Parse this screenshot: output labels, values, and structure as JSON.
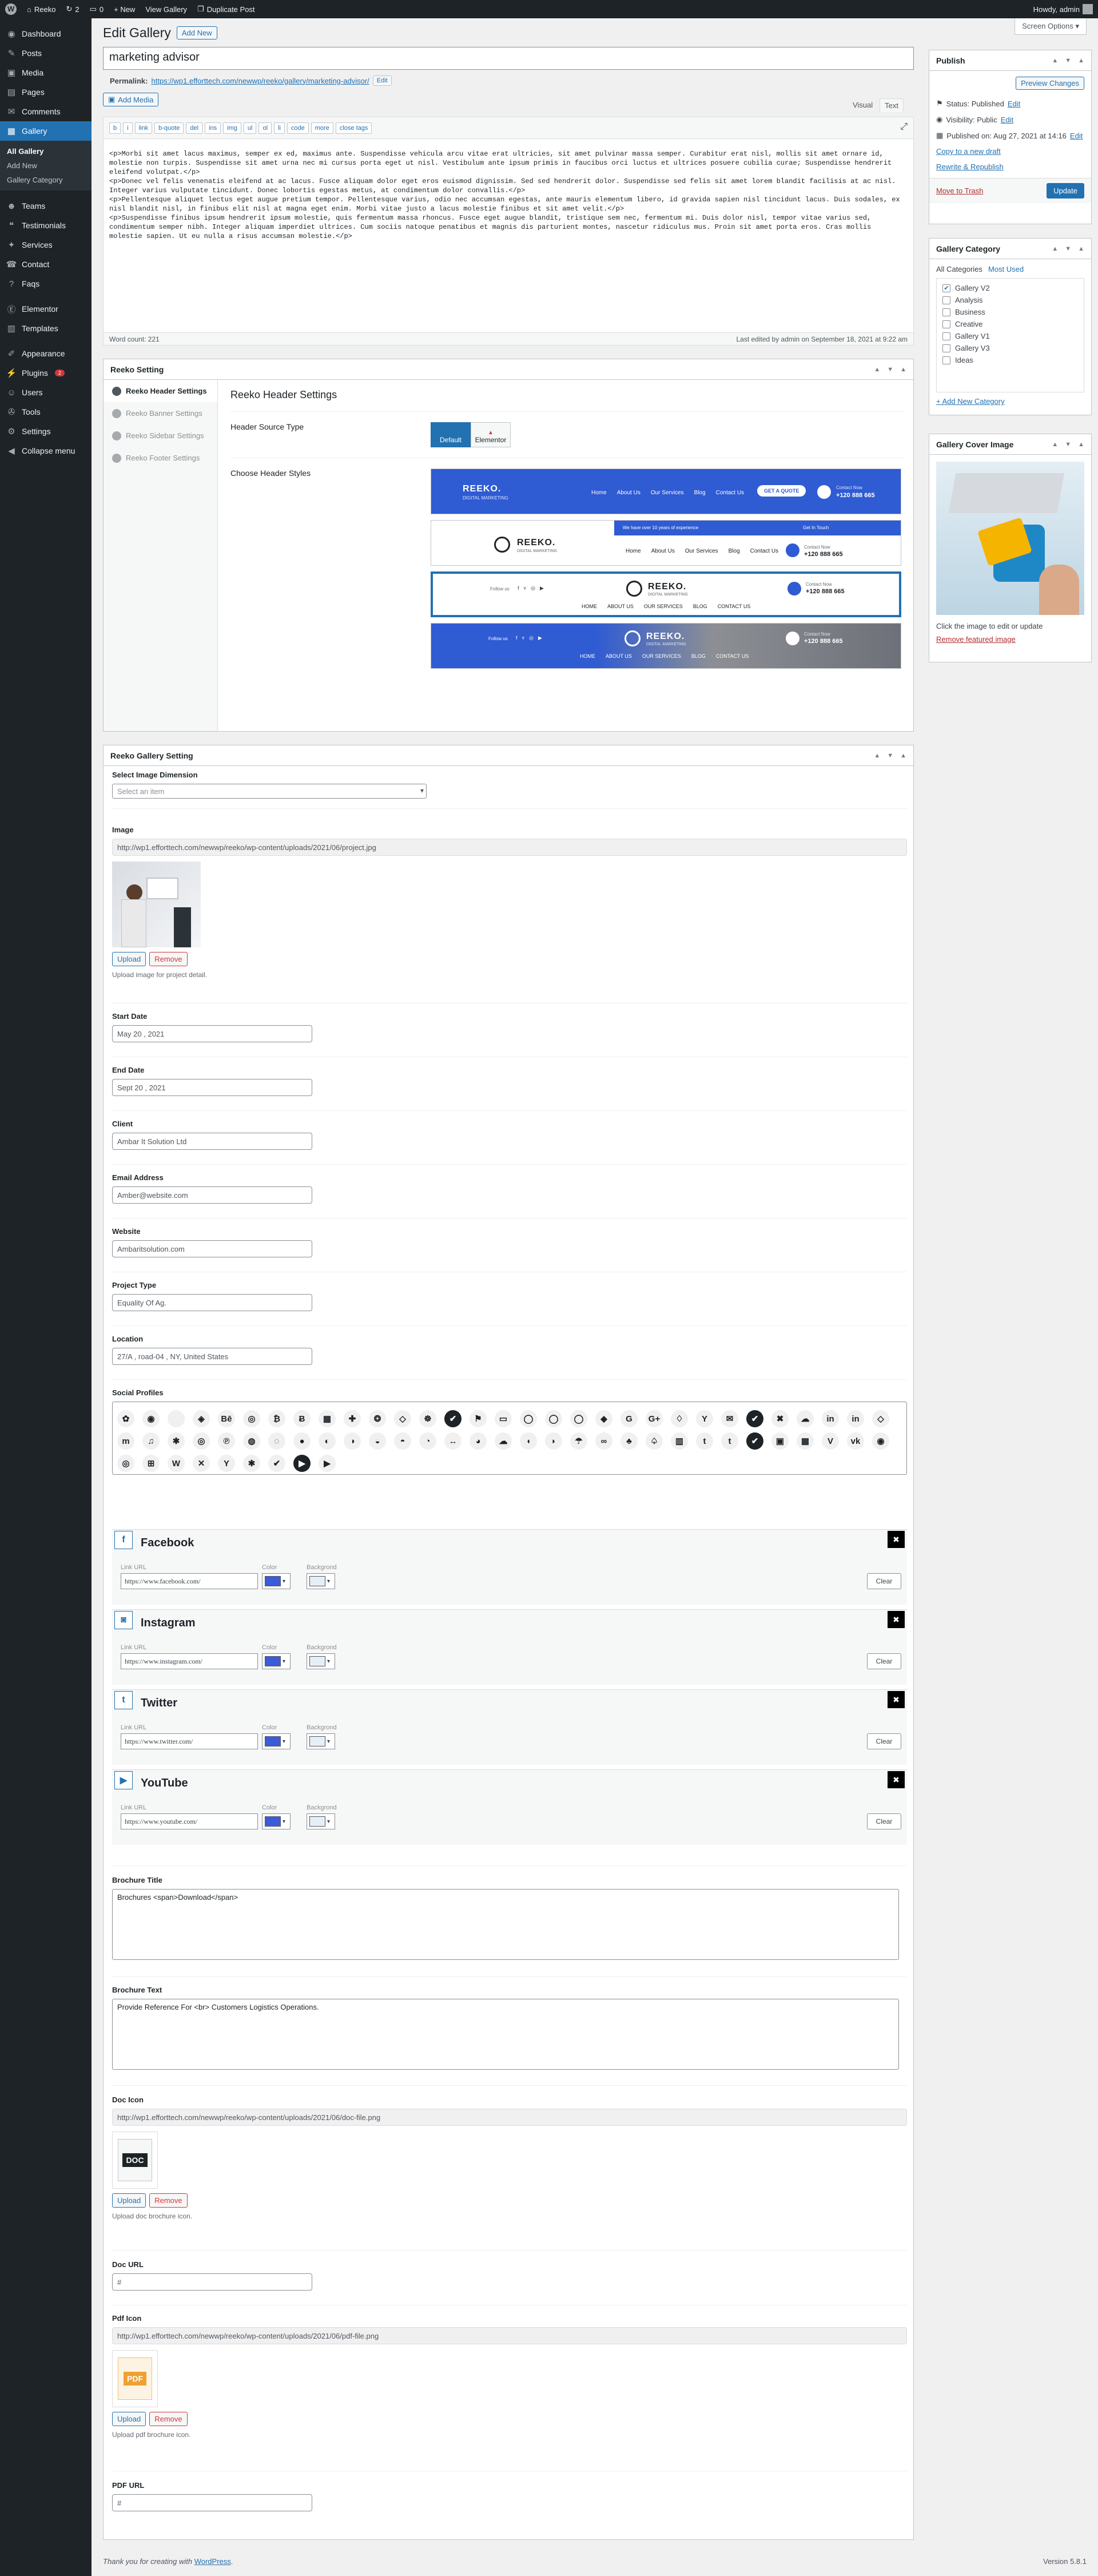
{
  "adminbar": {
    "site": "Reeko",
    "updates": "2",
    "comments": "0",
    "new": "+ New",
    "view": "View Gallery",
    "duplicate": "Duplicate Post",
    "howdy": "Howdy, admin"
  },
  "screen_options": "Screen Options",
  "sidebar": {
    "items": [
      {
        "label": "Dashboard",
        "icon": "dashboard-icon",
        "glyph": "◉"
      },
      {
        "label": "Posts",
        "icon": "pin-icon",
        "glyph": "✎"
      },
      {
        "label": "Media",
        "icon": "media-icon",
        "glyph": "▣"
      },
      {
        "label": "Pages",
        "icon": "pages-icon",
        "glyph": "▤"
      },
      {
        "label": "Comments",
        "icon": "comments-icon",
        "glyph": "✉"
      },
      {
        "label": "Gallery",
        "icon": "gallery-icon",
        "glyph": "▦"
      }
    ],
    "sub": [
      "All Gallery",
      "Add New",
      "Gallery Category"
    ],
    "items2": [
      {
        "label": "Teams",
        "icon": "teams-icon",
        "glyph": "☻"
      },
      {
        "label": "Testimonials",
        "icon": "testimonials-icon",
        "glyph": "❝"
      },
      {
        "label": "Services",
        "icon": "services-icon",
        "glyph": "✦"
      },
      {
        "label": "Contact",
        "icon": "contact-icon",
        "glyph": "☎"
      },
      {
        "label": "Faqs",
        "icon": "faqs-icon",
        "glyph": "?"
      }
    ],
    "items3": [
      {
        "label": "Elementor",
        "icon": "elementor-icon",
        "glyph": "Ⓔ"
      },
      {
        "label": "Templates",
        "icon": "templates-icon",
        "glyph": "▥"
      }
    ],
    "items4": [
      {
        "label": "Appearance",
        "icon": "appearance-icon",
        "glyph": "✐"
      },
      {
        "label": "Plugins",
        "icon": "plugins-icon",
        "glyph": "⚡",
        "badge": "2"
      },
      {
        "label": "Users",
        "icon": "users-icon",
        "glyph": "☺"
      },
      {
        "label": "Tools",
        "icon": "tools-icon",
        "glyph": "✇"
      },
      {
        "label": "Settings",
        "icon": "settings-icon",
        "glyph": "⚙"
      },
      {
        "label": "Collapse menu",
        "icon": "collapse-icon",
        "glyph": "◀"
      }
    ]
  },
  "page": {
    "title": "Edit Gallery",
    "add_new": "Add New",
    "post_title": "marketing advisor",
    "permalink_label": "Permalink:",
    "permalink_url": "https://wp1.efforttech.com/newwp/reeko/gallery/marketing-advisor/",
    "edit": "Edit",
    "add_media": "Add Media",
    "tab_visual": "Visual",
    "tab_text": "Text"
  },
  "editor": {
    "buttons": [
      "b",
      "i",
      "link",
      "b-quote",
      "del",
      "ins",
      "img",
      "ul",
      "ol",
      "li",
      "code",
      "more",
      "close tags"
    ],
    "content": "<p>Morbi sit amet lacus maximus, semper ex ed, maximus ante. Suspendisse vehicula arcu vitae erat ultricies, sit amet pulvinar massa semper. Curabitur erat nisl, mollis sit amet ornare id, molestie non turpis. Suspendisse sit amet urna nec mi cursus porta eget ut nisl. Vestibulum ante ipsum primis in faucibus orci luctus et ultrices posuere cubilia curae; Suspendisse hendrerit eleifend volutpat.</p>\n<p>Donec vel felis venenatis eleifend at ac lacus. Fusce aliquam dolor eget eros euismod dignissim. Sed sed hendrerit dolor. Suspendisse sed felis sit amet lorem blandit facilisis at ac nisl. Integer varius vulputate tincidunt. Donec lobortis egestas metus, at condimentum dolor convallis.</p>\n<p>Pellentesque aliquet lectus eget augue pretium tempor. Pellentesque varius, odio nec accumsan egestas, ante mauris elementum libero, id gravida sapien nisl tincidunt lacus. Duis sodales, ex nisl blandit nisl, in finibus elit nisl at magna eget enim. Morbi vitae justo a lacus molestie finibus et sit amet velit.</p>\n<p>Suspendisse finibus ipsum hendrerit ipsum molestie, quis fermentum massa rhoncus. Fusce eget augue blandit, tristique sem nec, fermentum mi. Duis dolor nisl, tempor vitae varius sed, condimentum semper nibh. Integer aliquam imperdiet ultrices. Cum sociis natoque penatibus et magnis dis parturient montes, nascetur ridiculus mus. Proin sit amet porta eros. Cras mollis molestie sapien. Ut eu nulla a risus accumsan molestie.</p>",
    "word_count": "Word count: 221",
    "last_edited": "Last edited by admin on September 18, 2021 at 9:22 am"
  },
  "reeko_setting": {
    "box_title": "Reeko Setting",
    "tabs": [
      "Reeko Header Settings",
      "Reeko Banner Settings",
      "Reeko Sidebar Settings",
      "Reeko Footer Settings"
    ],
    "section_title": "Reeko Header Settings",
    "source_label": "Header Source Type",
    "source_default": "Default",
    "source_elementor": "Elementor",
    "styles_label": "Choose Header Styles",
    "logo": "REEKO.",
    "tagline": "DIGITAL MARKETING",
    "nav": [
      "Home",
      "About Us",
      "Our Services",
      "Blog",
      "Contact Us"
    ],
    "nav_caps": [
      "HOME",
      "ABOUT US",
      "OUR SERVICES",
      "BLOG",
      "CONTACT US"
    ],
    "cta": "GET A QUOTE",
    "contact_label": "Contact Now",
    "phone": "+120 888 665",
    "follow": "Follow us",
    "notice": "We have over 10 years of experience",
    "touch": "Get In Touch"
  },
  "gallery_setting": {
    "box_title": "Reeko Gallery Setting",
    "dimension_label": "Select Image Dimension",
    "dimension_placeholder": "Select an item",
    "image_label": "Image",
    "image_url": "http://wp1.efforttech.com/newwp/reeko/wp-content/uploads/2021/06/project.jpg",
    "upload": "Upload",
    "remove": "Remove",
    "image_desc": "Upload image for project detail.",
    "start_label": "Start Date",
    "start": "May 20 , 2021",
    "end_label": "End Date",
    "end": "Sept 20 , 2021",
    "client_label": "Client",
    "client": "Ambar It Solution Ltd",
    "email_label": "Email Address",
    "email": "Amber@website.com",
    "website_label": "Website",
    "website": "Ambaritsolution.com",
    "type_label": "Project Type",
    "type": "Equality Of Ag.",
    "location_label": "Location",
    "location": "27/A , road-04 , NY, United States",
    "social_label": "Social Profiles",
    "brochure_title_label": "Brochure Title",
    "brochure_title": "Brochures <span>Download</span>",
    "brochure_text_label": "Brochure Text",
    "brochure_text": "Provide Reference For <br> Customers Logistics Operations.",
    "doc_icon_label": "Doc Icon",
    "doc_icon_url": "http://wp1.efforttech.com/newwp/reeko/wp-content/uploads/2021/06/doc-file.png",
    "doc_desc": "Upload doc brochure icon.",
    "doc_url_label": "Doc URL",
    "doc_url": "#",
    "pdf_icon_label": "Pdf Icon",
    "pdf_icon_url": "http://wp1.efforttech.com/newwp/reeko/wp-content/uploads/2021/06/pdf-file.png",
    "pdf_desc": "Upload pdf brochure icon.",
    "pdf_url_label": "PDF URL",
    "pdf_url": "#",
    "doc_thumb": "DOC",
    "pdf_thumb": "PDF"
  },
  "social_icons": [
    "✿",
    "◉",
    "",
    "◈",
    "Bē",
    "◎",
    "₿",
    "Ƀ",
    "▦",
    "✚",
    "❂",
    "◇",
    "☸",
    "✔",
    "⚑",
    "▭",
    "◯",
    "◯",
    "◯",
    "◆",
    "G",
    "G+",
    "♢",
    "Y",
    "✉",
    "✔",
    "✖",
    "☁",
    "in",
    "in",
    "◇",
    "m",
    "♫",
    "✱",
    "◎",
    "℗",
    "◍",
    "◌",
    "●",
    "◐",
    "◑",
    "◒",
    "◓",
    "◔",
    "↔",
    "◕",
    "☁",
    "◖",
    "◗",
    "☂",
    "∞",
    "♣",
    "♤",
    "▥",
    "t",
    "t",
    "✔",
    "▣",
    "▦",
    "V",
    "vk",
    "◉",
    "◎",
    "⊞",
    "W",
    "✕",
    "Y",
    "✱",
    "✔",
    "▶",
    "▶"
  ],
  "social_dark_indices": [
    13,
    25,
    56,
    69
  ],
  "social_cards": [
    {
      "name": "Facebook",
      "glyph": "f",
      "url": "https://www.facebook.com/"
    },
    {
      "name": "Instagram",
      "glyph": "◙",
      "url": "https://www.instagram.com/"
    },
    {
      "name": "Twitter",
      "glyph": "t",
      "url": "https://www.twitter.com/"
    },
    {
      "name": "YouTube",
      "glyph": "▶",
      "url": "https://www.youtube.com/"
    }
  ],
  "social_field_labels": {
    "url": "Link URL",
    "color": "Color",
    "bg": "Backgrond",
    "clear": "Clear"
  },
  "colors": {
    "accent": "#2271b1",
    "link_color_swatch": "#3b5bdb",
    "bg_swatch": "#e6eef8",
    "header_blue": "#2f5bd3"
  },
  "publish": {
    "title": "Publish",
    "preview": "Preview Changes",
    "status": "Status: Published",
    "visibility": "Visibility: Public",
    "published": "Published on: Aug 27, 2021 at 14:16",
    "edit": "Edit",
    "copy_draft": "Copy to a new draft",
    "rewrite": "Rewrite & Republish",
    "trash": "Move to Trash",
    "update": "Update"
  },
  "category": {
    "title": "Gallery Category",
    "tab_all": "All Categories",
    "tab_used": "Most Used",
    "items": [
      {
        "label": "Gallery V2",
        "checked": true
      },
      {
        "label": "Analysis",
        "checked": false
      },
      {
        "label": "Business",
        "checked": false
      },
      {
        "label": "Creative",
        "checked": false
      },
      {
        "label": "Gallery V1",
        "checked": false
      },
      {
        "label": "Gallery V3",
        "checked": false
      },
      {
        "label": "Ideas",
        "checked": false
      }
    ],
    "add_new": "+ Add New Category"
  },
  "cover": {
    "title": "Gallery Cover Image",
    "hint": "Click the image to edit or update",
    "remove": "Remove featured image"
  },
  "footer": {
    "thanks": "Thank you for creating with",
    "wp": "WordPress",
    "version": "Version 5.8.1"
  }
}
